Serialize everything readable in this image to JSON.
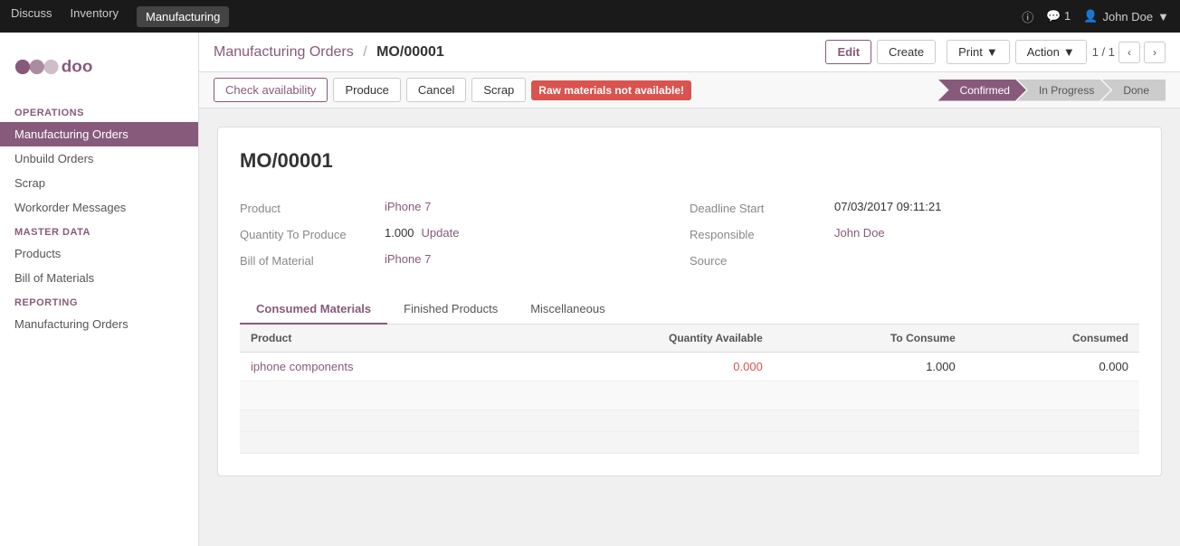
{
  "topNav": {
    "items": [
      "Discuss",
      "Inventory",
      "Manufacturing"
    ],
    "activeItem": "Manufacturing",
    "notifCount": "1",
    "user": "John Doe"
  },
  "sidebar": {
    "logo": "odoo",
    "sections": [
      {
        "title": "Operations",
        "items": [
          {
            "label": "Manufacturing Orders",
            "active": true
          },
          {
            "label": "Unbuild Orders",
            "active": false
          },
          {
            "label": "Scrap",
            "active": false
          },
          {
            "label": "Workorder Messages",
            "active": false
          }
        ]
      },
      {
        "title": "Master Data",
        "items": [
          {
            "label": "Products",
            "active": false
          },
          {
            "label": "Bill of Materials",
            "active": false
          }
        ]
      },
      {
        "title": "Reporting",
        "items": [
          {
            "label": "Manufacturing Orders",
            "active": false
          }
        ]
      }
    ]
  },
  "header": {
    "breadcrumbParent": "Manufacturing Orders",
    "breadcrumbSep": "/",
    "breadcrumbCurrent": "MO/00001",
    "pager": "1 / 1",
    "buttons": {
      "edit": "Edit",
      "create": "Create",
      "print": "Print",
      "action": "Action"
    }
  },
  "statusBar": {
    "buttons": [
      "Check availability",
      "Produce",
      "Cancel",
      "Scrap"
    ],
    "badge": "Raw materials not available!",
    "steps": [
      "Confirmed",
      "In Progress",
      "Done"
    ]
  },
  "form": {
    "title": "MO/00001",
    "fields": {
      "product": {
        "label": "Product",
        "value": "iPhone 7"
      },
      "quantityToProduce": {
        "label": "Quantity To Produce",
        "value": "1.000"
      },
      "updateBtn": "Update",
      "billOfMaterial": {
        "label": "Bill of Material",
        "value": "iPhone 7"
      },
      "deadlineStart": {
        "label": "Deadline Start",
        "value": "07/03/2017 09:11:21"
      },
      "responsible": {
        "label": "Responsible",
        "value": "John Doe"
      },
      "source": {
        "label": "Source",
        "value": ""
      }
    }
  },
  "tabs": [
    {
      "label": "Consumed Materials",
      "active": true
    },
    {
      "label": "Finished Products",
      "active": false
    },
    {
      "label": "Miscellaneous",
      "active": false
    }
  ],
  "table": {
    "columns": [
      "Product",
      "Quantity Available",
      "To Consume",
      "Consumed"
    ],
    "rows": [
      {
        "product": "iphone components",
        "quantityAvailable": "0.000",
        "toConsume": "1.000",
        "consumed": "0.000"
      }
    ]
  }
}
